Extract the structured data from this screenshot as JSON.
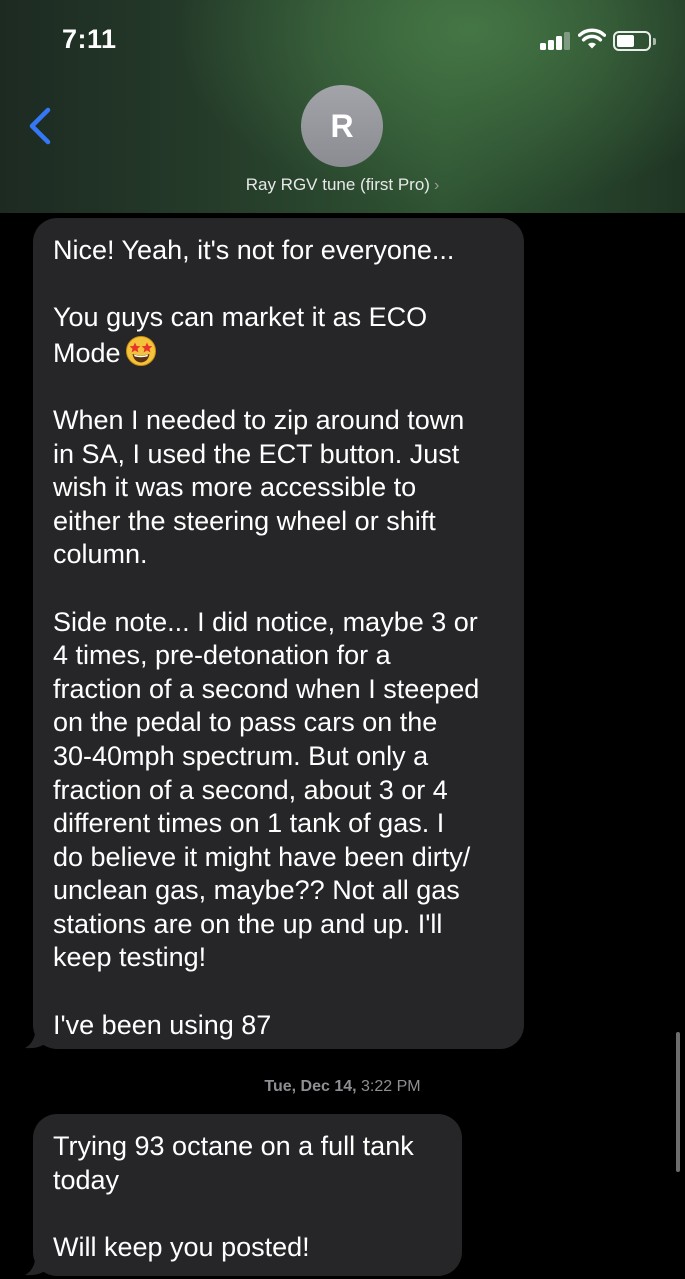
{
  "status_bar": {
    "time": "7:11"
  },
  "contact": {
    "avatar_initial": "R",
    "name": "Ray RGV tune (first Pro)",
    "chevron": "›"
  },
  "messages": [
    {
      "paragraphs": [
        "Nice!  Yeah, it's not for everyone...",
        "You guys can market it as ECO\nMode",
        "When I needed to zip around town\nin SA, I used the ECT button.  Just\nwish it was more accessible to\neither the steering wheel or shift\ncolumn.",
        "Side note... I did notice, maybe 3 or\n4 times, pre-detonation for a\nfraction of a second when I steeped\non the pedal to pass cars on the\n30-40mph spectrum.  But only a\nfraction of a second, about 3 or 4\ndifferent times on 1 tank of gas.   I\ndo believe it might have been dirty/\nunclean gas, maybe??  Not all gas\nstations are on the up and up.  I'll\nkeep testing!",
        "I've been using 87"
      ],
      "emoji": "star-struck-emoji"
    },
    {
      "paragraphs": [
        "Trying 93 octane on a full tank\ntoday",
        "Will keep you posted!"
      ]
    }
  ],
  "timestamp": {
    "day": "Tue, Dec 14,",
    "time": "3:22 PM"
  },
  "icons": {
    "back": "chevron-left-icon",
    "signal": "cellular-signal-icon",
    "wifi": "wifi-icon",
    "battery": "battery-icon"
  },
  "colors": {
    "bubble": "#262628",
    "accent": "#3478f6",
    "timestamp": "#8e8e93"
  }
}
